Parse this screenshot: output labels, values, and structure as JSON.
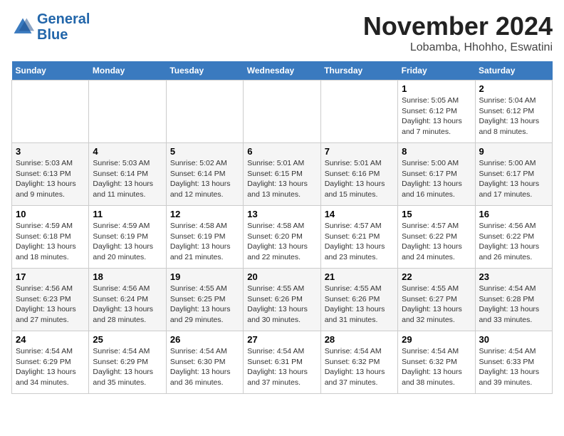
{
  "header": {
    "logo_line1": "General",
    "logo_line2": "Blue",
    "month": "November 2024",
    "location": "Lobamba, Hhohho, Eswatini"
  },
  "days_of_week": [
    "Sunday",
    "Monday",
    "Tuesday",
    "Wednesday",
    "Thursday",
    "Friday",
    "Saturday"
  ],
  "weeks": [
    [
      {
        "day": "",
        "info": ""
      },
      {
        "day": "",
        "info": ""
      },
      {
        "day": "",
        "info": ""
      },
      {
        "day": "",
        "info": ""
      },
      {
        "day": "",
        "info": ""
      },
      {
        "day": "1",
        "info": "Sunrise: 5:05 AM\nSunset: 6:12 PM\nDaylight: 13 hours and 7 minutes."
      },
      {
        "day": "2",
        "info": "Sunrise: 5:04 AM\nSunset: 6:12 PM\nDaylight: 13 hours and 8 minutes."
      }
    ],
    [
      {
        "day": "3",
        "info": "Sunrise: 5:03 AM\nSunset: 6:13 PM\nDaylight: 13 hours and 9 minutes."
      },
      {
        "day": "4",
        "info": "Sunrise: 5:03 AM\nSunset: 6:14 PM\nDaylight: 13 hours and 11 minutes."
      },
      {
        "day": "5",
        "info": "Sunrise: 5:02 AM\nSunset: 6:14 PM\nDaylight: 13 hours and 12 minutes."
      },
      {
        "day": "6",
        "info": "Sunrise: 5:01 AM\nSunset: 6:15 PM\nDaylight: 13 hours and 13 minutes."
      },
      {
        "day": "7",
        "info": "Sunrise: 5:01 AM\nSunset: 6:16 PM\nDaylight: 13 hours and 15 minutes."
      },
      {
        "day": "8",
        "info": "Sunrise: 5:00 AM\nSunset: 6:17 PM\nDaylight: 13 hours and 16 minutes."
      },
      {
        "day": "9",
        "info": "Sunrise: 5:00 AM\nSunset: 6:17 PM\nDaylight: 13 hours and 17 minutes."
      }
    ],
    [
      {
        "day": "10",
        "info": "Sunrise: 4:59 AM\nSunset: 6:18 PM\nDaylight: 13 hours and 18 minutes."
      },
      {
        "day": "11",
        "info": "Sunrise: 4:59 AM\nSunset: 6:19 PM\nDaylight: 13 hours and 20 minutes."
      },
      {
        "day": "12",
        "info": "Sunrise: 4:58 AM\nSunset: 6:19 PM\nDaylight: 13 hours and 21 minutes."
      },
      {
        "day": "13",
        "info": "Sunrise: 4:58 AM\nSunset: 6:20 PM\nDaylight: 13 hours and 22 minutes."
      },
      {
        "day": "14",
        "info": "Sunrise: 4:57 AM\nSunset: 6:21 PM\nDaylight: 13 hours and 23 minutes."
      },
      {
        "day": "15",
        "info": "Sunrise: 4:57 AM\nSunset: 6:22 PM\nDaylight: 13 hours and 24 minutes."
      },
      {
        "day": "16",
        "info": "Sunrise: 4:56 AM\nSunset: 6:22 PM\nDaylight: 13 hours and 26 minutes."
      }
    ],
    [
      {
        "day": "17",
        "info": "Sunrise: 4:56 AM\nSunset: 6:23 PM\nDaylight: 13 hours and 27 minutes."
      },
      {
        "day": "18",
        "info": "Sunrise: 4:56 AM\nSunset: 6:24 PM\nDaylight: 13 hours and 28 minutes."
      },
      {
        "day": "19",
        "info": "Sunrise: 4:55 AM\nSunset: 6:25 PM\nDaylight: 13 hours and 29 minutes."
      },
      {
        "day": "20",
        "info": "Sunrise: 4:55 AM\nSunset: 6:26 PM\nDaylight: 13 hours and 30 minutes."
      },
      {
        "day": "21",
        "info": "Sunrise: 4:55 AM\nSunset: 6:26 PM\nDaylight: 13 hours and 31 minutes."
      },
      {
        "day": "22",
        "info": "Sunrise: 4:55 AM\nSunset: 6:27 PM\nDaylight: 13 hours and 32 minutes."
      },
      {
        "day": "23",
        "info": "Sunrise: 4:54 AM\nSunset: 6:28 PM\nDaylight: 13 hours and 33 minutes."
      }
    ],
    [
      {
        "day": "24",
        "info": "Sunrise: 4:54 AM\nSunset: 6:29 PM\nDaylight: 13 hours and 34 minutes."
      },
      {
        "day": "25",
        "info": "Sunrise: 4:54 AM\nSunset: 6:29 PM\nDaylight: 13 hours and 35 minutes."
      },
      {
        "day": "26",
        "info": "Sunrise: 4:54 AM\nSunset: 6:30 PM\nDaylight: 13 hours and 36 minutes."
      },
      {
        "day": "27",
        "info": "Sunrise: 4:54 AM\nSunset: 6:31 PM\nDaylight: 13 hours and 37 minutes."
      },
      {
        "day": "28",
        "info": "Sunrise: 4:54 AM\nSunset: 6:32 PM\nDaylight: 13 hours and 37 minutes."
      },
      {
        "day": "29",
        "info": "Sunrise: 4:54 AM\nSunset: 6:32 PM\nDaylight: 13 hours and 38 minutes."
      },
      {
        "day": "30",
        "info": "Sunrise: 4:54 AM\nSunset: 6:33 PM\nDaylight: 13 hours and 39 minutes."
      }
    ]
  ]
}
